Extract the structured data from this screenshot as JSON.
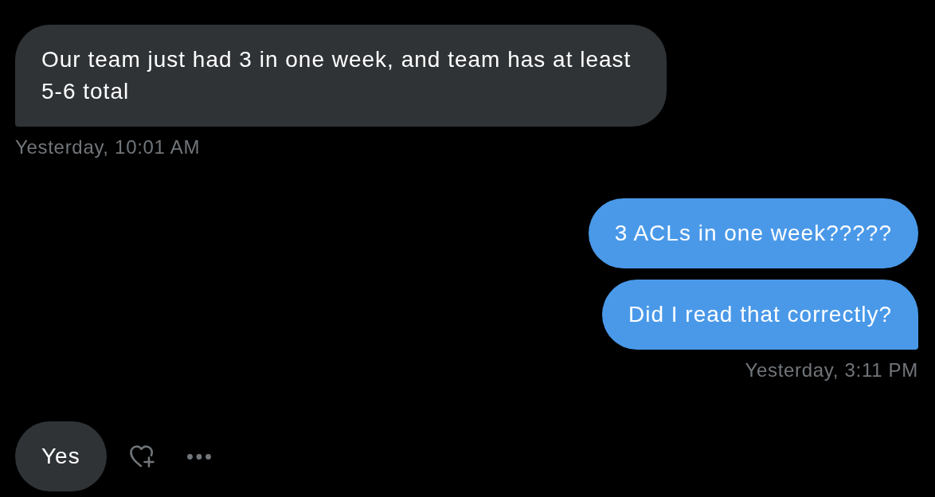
{
  "conversation": [
    {
      "kind": "received",
      "bubbles": [
        "Our team just had 3 in one week, and team has at least 5-6 total"
      ],
      "timestamp": "Yesterday, 10:01 AM",
      "show_actions": false
    },
    {
      "kind": "sent",
      "bubbles": [
        "3 ACLs in one week?????",
        "Did I read that correctly?"
      ],
      "timestamp": "Yesterday, 3:11 PM",
      "show_actions": false
    },
    {
      "kind": "received",
      "bubbles": [
        "Yes"
      ],
      "show_actions": true
    }
  ]
}
